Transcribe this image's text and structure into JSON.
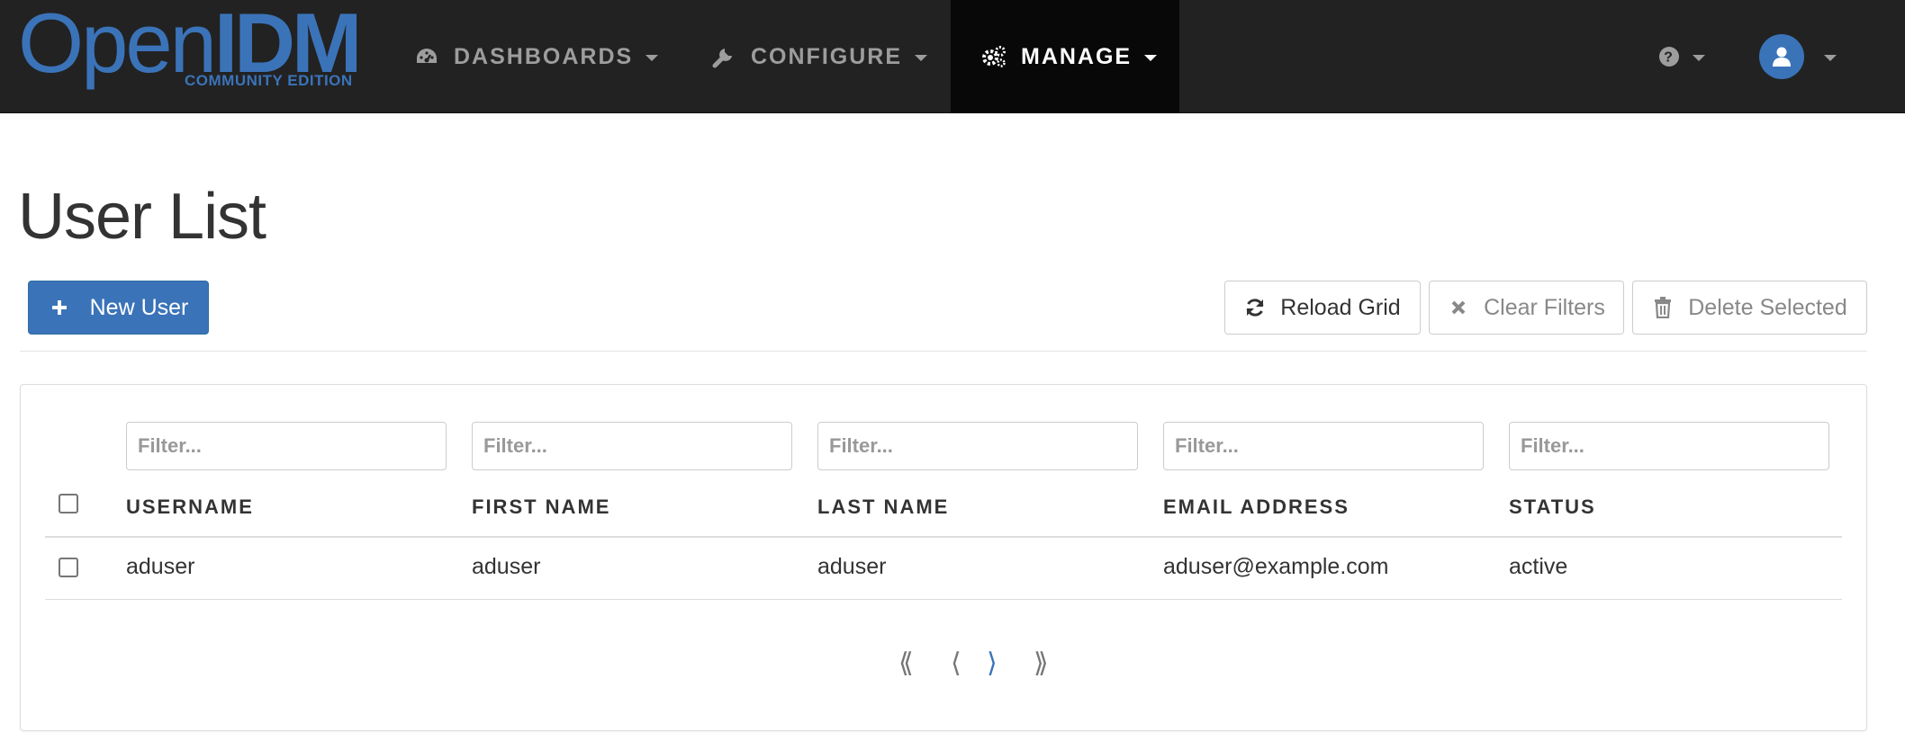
{
  "logo": {
    "open": "Open",
    "idm": "IDM",
    "edition": "COMMUNITY EDITION"
  },
  "nav": {
    "dashboards": "DASHBOARDS",
    "configure": "CONFIGURE",
    "manage": "MANAGE"
  },
  "page": {
    "title": "User List"
  },
  "toolbar": {
    "new_user": "New User",
    "reload_grid": "Reload Grid",
    "clear_filters": "Clear Filters",
    "delete_selected": "Delete Selected"
  },
  "grid": {
    "filter_placeholder": "Filter...",
    "columns": [
      "USERNAME",
      "FIRST NAME",
      "LAST NAME",
      "EMAIL ADDRESS",
      "STATUS"
    ],
    "rows": [
      [
        "aduser",
        "aduser",
        "aduser",
        "aduser@example.com",
        "active"
      ]
    ]
  },
  "pager": {
    "first": "⟪",
    "prev": "⟨",
    "next": "⟩",
    "last": "⟫"
  },
  "colors": {
    "navbar": "#222222",
    "nav_active": "#080808",
    "accent": "#3b73b9",
    "nav_text": "#9d9d9d"
  }
}
